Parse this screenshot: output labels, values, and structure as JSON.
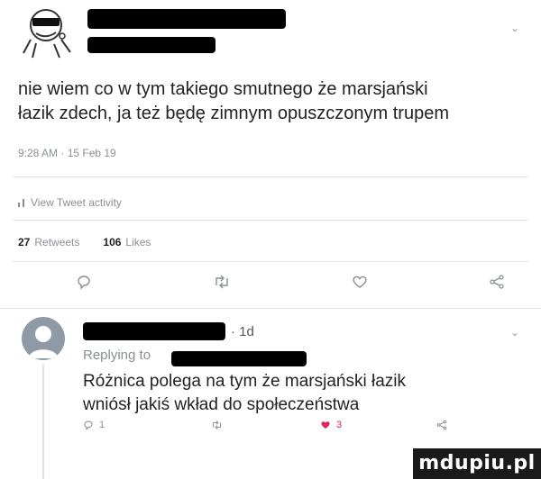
{
  "tweet": {
    "text": "nie wiem co w tym takiego smutnego że marsjański\nłazik zdech, ja też będę zimnym opuszczonym trupem",
    "timestamp": "9:28 AM · 15 Feb 19",
    "activity_label": "View Tweet activity",
    "retweets_count": "27",
    "retweets_label": "Retweets",
    "likes_count": "106",
    "likes_label": "Likes"
  },
  "reply": {
    "time": "· 1d",
    "replying_label": "Replying to",
    "text": "Różnica polega na tym że marsjański łazik\nwniósł jakiś wkład do społeczeństwa",
    "reply_count": "1",
    "like_count": "3"
  },
  "watermark": "mdupiu.pl",
  "icons": [
    "avatar-meme-face",
    "chevron-down-icon",
    "bar-chart-icon",
    "reply-icon",
    "retweet-icon",
    "heart-icon",
    "share-icon"
  ],
  "colors": {
    "muted": "#8a8f94",
    "like": "#e0245e",
    "redaction": "#000000"
  }
}
